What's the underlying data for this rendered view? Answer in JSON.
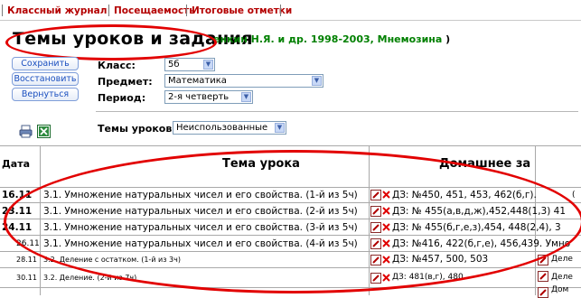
{
  "tabs": [
    {
      "label": "Классный журнал"
    },
    {
      "label": "Посещаемость"
    },
    {
      "label": "Итоговые отметки"
    }
  ],
  "title": {
    "main": "Темы уроков и задания",
    "suffix": "енкин Н.Я. и др. 1998-2003, Мнемозина",
    "close_paren": ")"
  },
  "buttons": {
    "save": "Сохранить",
    "restore": "Восстановить",
    "back": "Вернуться"
  },
  "form": {
    "class_label": "Класс:",
    "class_value": "5б",
    "subject_label": "Предмет:",
    "subject_value": "Математика",
    "period_label": "Период:",
    "period_value": "2-я четверть",
    "topics_label": "Темы уроков:",
    "topics_value": "Неиспользованные"
  },
  "table": {
    "col_date": "Дата",
    "col_topic": "Тема урока",
    "col_homework": "Домашнее за",
    "rows": [
      {
        "date": "16.11",
        "topic": "3.1. Умножение натуральных чисел и его свойства. (1-й из 5ч)",
        "hw": "ДЗ: №450, 451, 453, 462(б,г).",
        "extra": "("
      },
      {
        "date": "23.11",
        "topic": "3.1. Умножение натуральных чисел и его свойства. (2-й из 5ч)",
        "hw": "ДЗ: № 455(а,в,д,ж),452,448(1,3) 41",
        "extra": ""
      },
      {
        "date": "24.11",
        "topic": "3.1. Умножение натуральных чисел и его свойства. (3-й из 5ч)",
        "hw": "ДЗ: № 455(б,г,е,з),454, 448(2,4), 3",
        "extra": ""
      },
      {
        "date": "26.11",
        "topic": "3.1. Умножение натуральных чисел и его свойства. (4-й из 5ч)",
        "hw": "ДЗ: №416, 422(б,г,е), 456,439. Умно",
        "extra": ""
      },
      {
        "date": "28.11",
        "topic": "3.2. Деление с остатком. (1-й из 3ч)",
        "hw": "ДЗ: №457, 500, 503",
        "extra": "Деле"
      },
      {
        "date": "30.11",
        "topic": "3.2. Деление. (2-й из 7ч)",
        "hw": "ДЗ: 481(в,г), 480.",
        "extra": "Деле"
      },
      {
        "date": "",
        "topic": "",
        "hw": "",
        "extra": "Дом"
      }
    ]
  }
}
